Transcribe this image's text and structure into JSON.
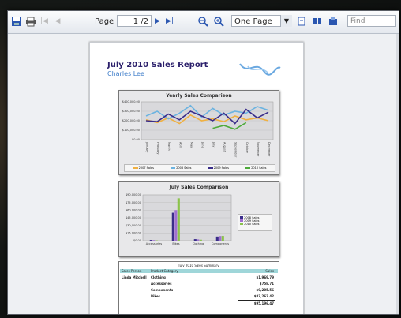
{
  "toolbar": {
    "page_label": "Page",
    "page_value": "1 /2",
    "zoom_value": "One Page",
    "find_placeholder": "Find"
  },
  "report": {
    "title": "July 2010 Sales Report",
    "author": "Charles Lee",
    "charts": [
      {
        "title": "Yearly Sales Comparison",
        "legend": [
          "2007 Sales",
          "2008 Sales",
          "2009 Sales",
          "2010 Sales"
        ]
      },
      {
        "title": "July Sales Comparison",
        "legend": [
          "2008 Sales",
          "2009 Sales",
          "2010 Sales"
        ],
        "categories": [
          "Accessories",
          "Bikes",
          "Clothing",
          "Components"
        ]
      }
    ],
    "table": {
      "title": "July 2010 Sales Summary",
      "header_left": "Sales Person",
      "header_mid": "Product Category",
      "header_right": "Sales",
      "person": "Linda Mitchell",
      "rows": [
        {
          "category": "Clothing",
          "value": "$1,969.79"
        },
        {
          "category": "Accessories",
          "value": "$758.71"
        },
        {
          "category": "Components",
          "value": "$9,205.56"
        },
        {
          "category": "Bikes",
          "value": "$83,262.42"
        },
        {
          "category": "",
          "value": "$95,196.47"
        }
      ]
    }
  },
  "chart_data": [
    {
      "type": "line",
      "title": "Yearly Sales Comparison",
      "categories": [
        "January",
        "February",
        "March",
        "April",
        "May",
        "June",
        "July",
        "August",
        "September",
        "October",
        "November",
        "December"
      ],
      "series": [
        {
          "name": "2007 Sales",
          "color": "#f0b040",
          "values": [
            210000,
            180000,
            230000,
            170000,
            260000,
            200000,
            220000,
            190000,
            250000,
            210000,
            230000,
            200000
          ]
        },
        {
          "name": "2008 Sales",
          "color": "#6bb3e0",
          "values": [
            250000,
            300000,
            220000,
            280000,
            360000,
            240000,
            330000,
            260000,
            300000,
            280000,
            350000,
            310000
          ]
        },
        {
          "name": "2009 Sales",
          "color": "#3a2d8a",
          "values": [
            200000,
            190000,
            270000,
            210000,
            300000,
            250000,
            200000,
            280000,
            170000,
            320000,
            230000,
            290000
          ]
        },
        {
          "name": "2010 Sales",
          "color": "#4daa3a",
          "values": [
            null,
            null,
            null,
            null,
            null,
            null,
            120000,
            150000,
            110000,
            180000,
            null,
            null
          ]
        }
      ],
      "ylim": [
        0,
        400000
      ]
    },
    {
      "type": "bar",
      "title": "July Sales Comparison",
      "categories": [
        "Accessories",
        "Bikes",
        "Clothing",
        "Components"
      ],
      "series": [
        {
          "name": "2008 Sales",
          "color": "#3a2d8a",
          "values": [
            1500,
            55000,
            3000,
            8000
          ]
        },
        {
          "name": "2009 Sales",
          "color": "#a070d0",
          "values": [
            1200,
            60000,
            2500,
            9000
          ]
        },
        {
          "name": "2010 Sales",
          "color": "#8bc34a",
          "values": [
            758.71,
            83262.42,
            1969.79,
            9205.56
          ]
        }
      ],
      "ylim": [
        0,
        90000
      ]
    }
  ],
  "colors": {
    "accent": "#2b1f6b",
    "subtitle": "#3d7cc9",
    "table_header": "#9fd6d9"
  }
}
